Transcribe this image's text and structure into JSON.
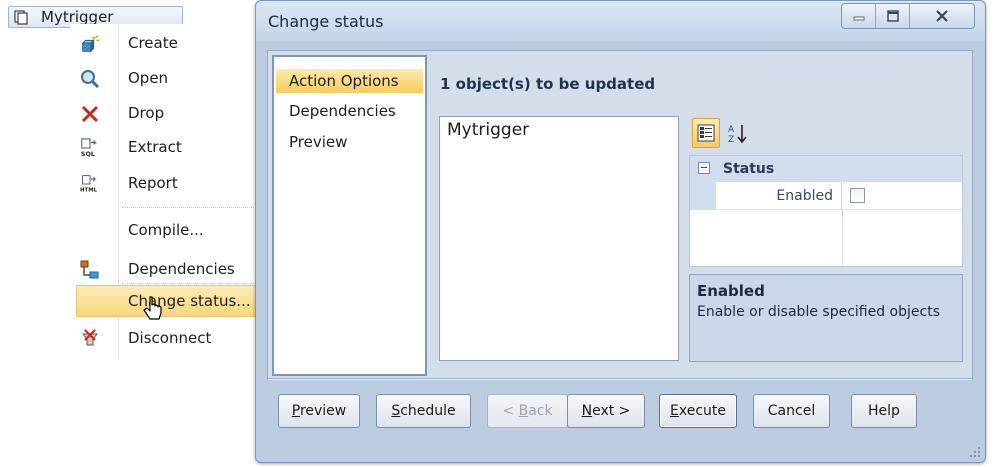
{
  "tree": {
    "node_label": "Mytrigger"
  },
  "context_menu": {
    "items": [
      {
        "label": "Create",
        "icon": "create-icon"
      },
      {
        "label": "Open",
        "icon": "magnifier-icon"
      },
      {
        "label": "Drop",
        "icon": "red-x-icon"
      },
      {
        "label": "Extract",
        "icon": "sql-extract-icon"
      },
      {
        "label": "Report",
        "icon": "html-report-icon"
      },
      {
        "label": "Compile...",
        "icon": ""
      },
      {
        "label": "Dependencies",
        "icon": "dependencies-icon"
      },
      {
        "label": "Change status...",
        "icon": ""
      },
      {
        "label": "Disconnect",
        "icon": "disconnect-icon"
      }
    ],
    "selected": "Change status..."
  },
  "dialog": {
    "title": "Change status",
    "nav": [
      {
        "label": "Action Options",
        "active": true
      },
      {
        "label": "Dependencies",
        "active": false
      },
      {
        "label": "Preview",
        "active": false
      }
    ],
    "update_label": "1 object(s) to be updated",
    "objects": [
      "Mytrigger"
    ],
    "property_grid": {
      "category": "Status",
      "property_name": "Enabled",
      "property_value": false
    },
    "description": {
      "title": "Enabled",
      "text": "Enable or disable specified objects"
    },
    "buttons": {
      "preview": {
        "pre": "",
        "key": "P",
        "post": "review"
      },
      "schedule": {
        "pre": "",
        "key": "S",
        "post": "chedule"
      },
      "back": {
        "pre": "< ",
        "key": "B",
        "post": "ack"
      },
      "next": {
        "pre": "",
        "key": "N",
        "post": "ext >"
      },
      "execute": {
        "pre": "",
        "key": "E",
        "post": "xecute"
      },
      "cancel": "Cancel",
      "help": "Help"
    }
  },
  "colors": {
    "dialog_bg": "#bccde2",
    "selection": "#f8d67c",
    "nav_active": "#f8cd5f"
  }
}
